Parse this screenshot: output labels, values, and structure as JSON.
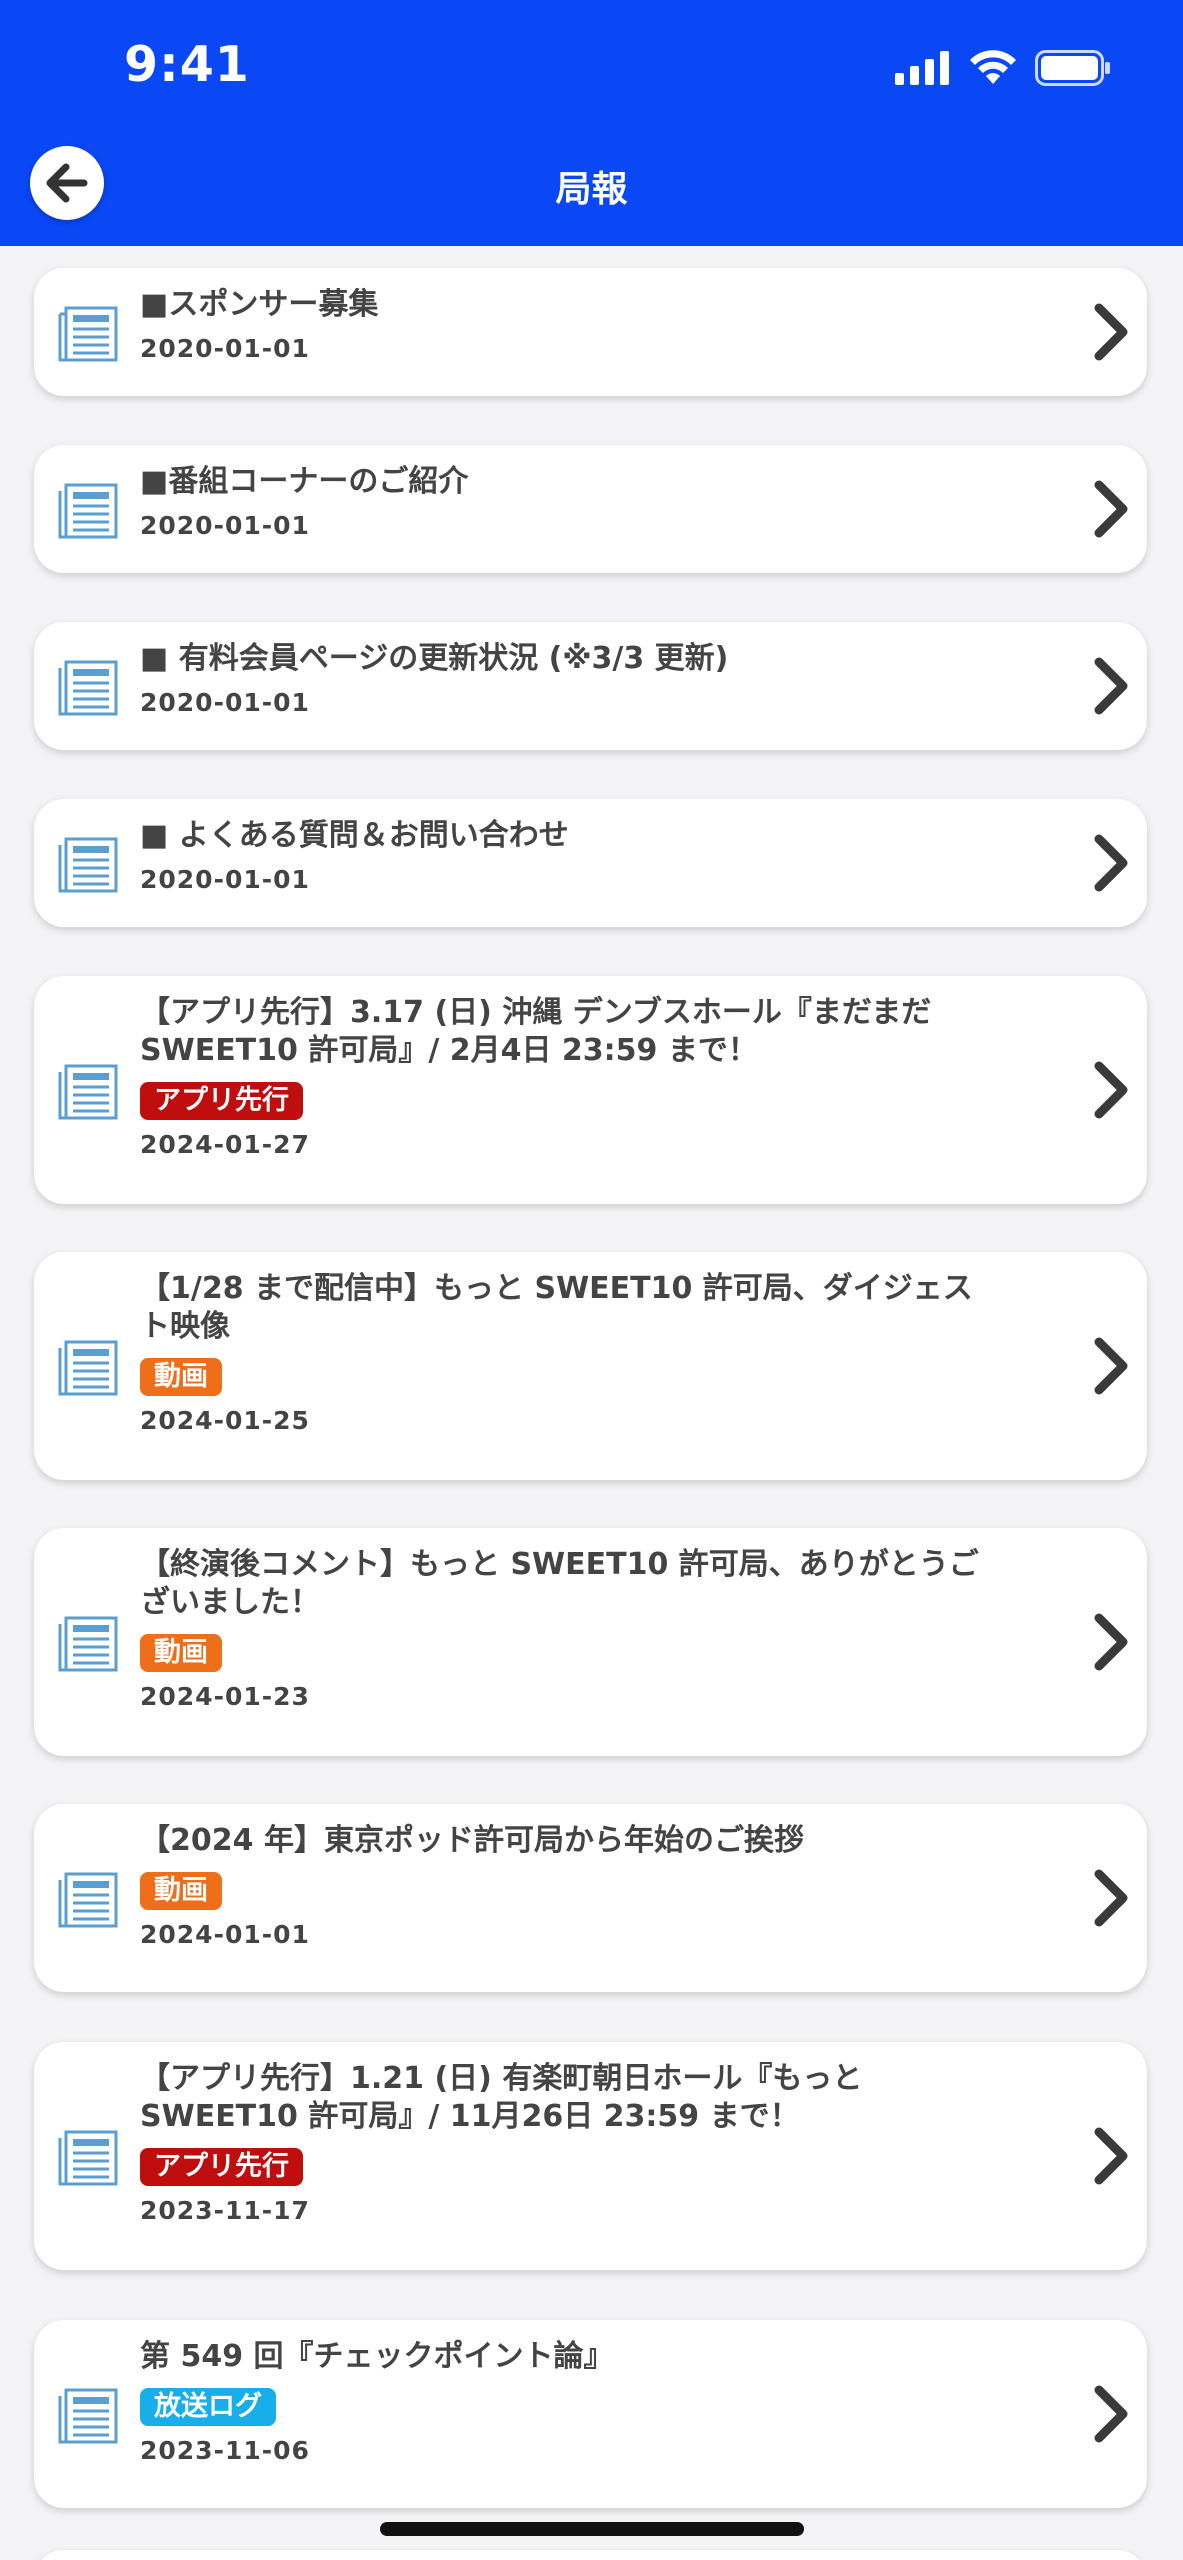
{
  "status_bar": {
    "time": "9:41"
  },
  "header": {
    "title": "局報"
  },
  "colors": {
    "header_bg": "#0a47f5",
    "tag_app": "#c00d0d",
    "tag_video": "#ef6e1a",
    "tag_broadcast": "#18aeea",
    "icon_blue": "#5a9fd0"
  },
  "items": [
    {
      "title": "■スポンサー募集",
      "date": "2020-01-01"
    },
    {
      "title": "■番組コーナーのご紹介",
      "date": "2020-01-01"
    },
    {
      "title": "■ 有料会員ページの更新状況 (※3/3 更新)",
      "date": "2020-01-01"
    },
    {
      "title": "■ よくある質問＆お問い合わせ",
      "date": "2020-01-01"
    },
    {
      "title": "【アプリ先行】3.17 (日) 沖縄 デンブスホール『まだまだ SWEET10 許可局』/ 2月4日 23:59 まで！",
      "tag": "アプリ先行",
      "date": "2024-01-27"
    },
    {
      "title": "【1/28 まで配信中】もっと SWEET10 許可局、ダイジェスト映像",
      "tag": "動画",
      "date": "2024-01-25"
    },
    {
      "title": "【終演後コメント】もっと SWEET10 許可局、ありがとうございました！",
      "tag": "動画",
      "date": "2024-01-23"
    },
    {
      "title": "【2024 年】東京ポッド許可局から年始のご挨拶",
      "tag": "動画",
      "date": "2024-01-01"
    },
    {
      "title": "【アプリ先行】1.21 (日) 有楽町朝日ホール『もっと SWEET10 許可局』/ 11月26日 23:59 まで！",
      "tag": "アプリ先行",
      "date": "2023-11-17"
    },
    {
      "title": "第 549 回『チェックポイント論』",
      "tag": "放送ログ",
      "date": "2023-11-06"
    }
  ]
}
